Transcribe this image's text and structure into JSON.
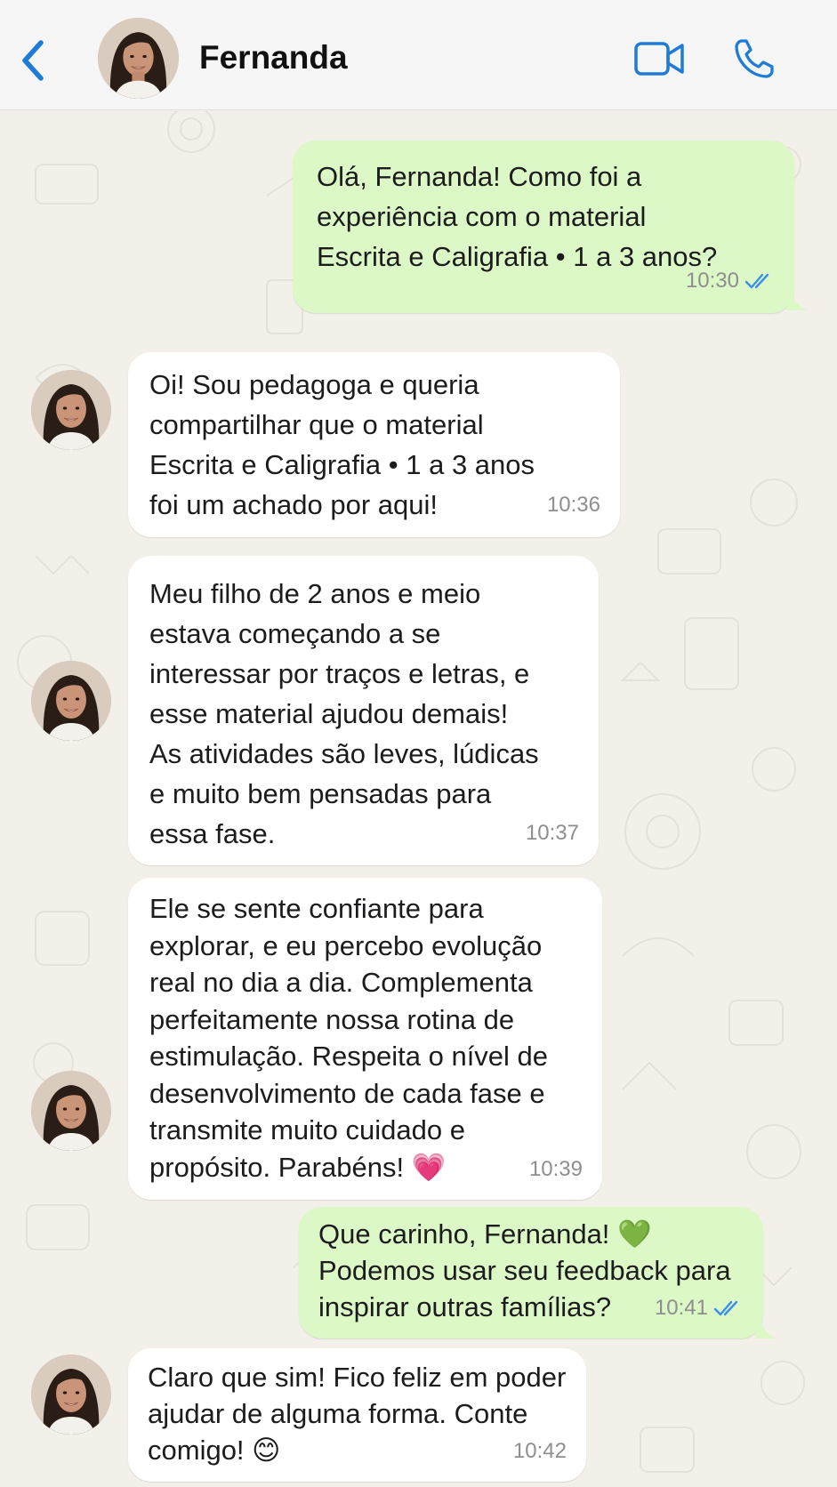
{
  "header": {
    "contact_name": "Fernanda",
    "back_icon": "chevron-left-icon",
    "video_icon": "video-camera-icon",
    "phone_icon": "phone-icon"
  },
  "colors": {
    "accent": "#1f7bd8",
    "outgoing_bubble": "#dcf8c6",
    "incoming_bubble": "#ffffff",
    "chat_background": "#f3f0ea",
    "header_background": "#f6f6f6",
    "read_ticks": "#3b8ee8"
  },
  "messages": [
    {
      "direction": "outgoing",
      "lines": [
        "Olá, Fernanda! Como foi a",
        "experiência com o material",
        "Escrita e Caligrafia • 1 a 3 anos?"
      ],
      "time": "10:30",
      "status": "read"
    },
    {
      "direction": "incoming",
      "lines": [
        "Oi! Sou pedagoga e queria",
        "compartilhar que o material",
        "Escrita e Caligrafia • 1 a 3 anos",
        "foi um achado por aqui!"
      ],
      "time": "10:36"
    },
    {
      "direction": "incoming",
      "lines": [
        "Meu filho de 2 anos e meio",
        "estava começando a se",
        "interessar por traços e letras, e",
        "esse material ajudou demais!",
        "As atividades são leves, lúdicas",
        "e muito bem pensadas para",
        "essa fase."
      ],
      "time": "10:37"
    },
    {
      "direction": "incoming",
      "lines": [
        "Ele se sente confiante para",
        "explorar, e eu percebo evolução",
        "real no dia a dia. Complementa",
        "perfeitamente nossa rotina de",
        "estimulação. Respeita o nível de",
        "desenvolvimento de cada fase e",
        "transmite muito cuidado e",
        "propósito. Parabéns! 💗"
      ],
      "time": "10:39"
    },
    {
      "direction": "outgoing",
      "lines": [
        "Que carinho, Fernanda! 💚",
        "Podemos usar seu feedback para",
        "inspirar outras famílias?"
      ],
      "time": "10:41",
      "status": "read"
    },
    {
      "direction": "incoming",
      "lines": [
        "Claro que sim! Fico feliz em poder",
        "ajudar de alguma forma. Conte",
        "comigo! 😊"
      ],
      "time": "10:42"
    }
  ]
}
